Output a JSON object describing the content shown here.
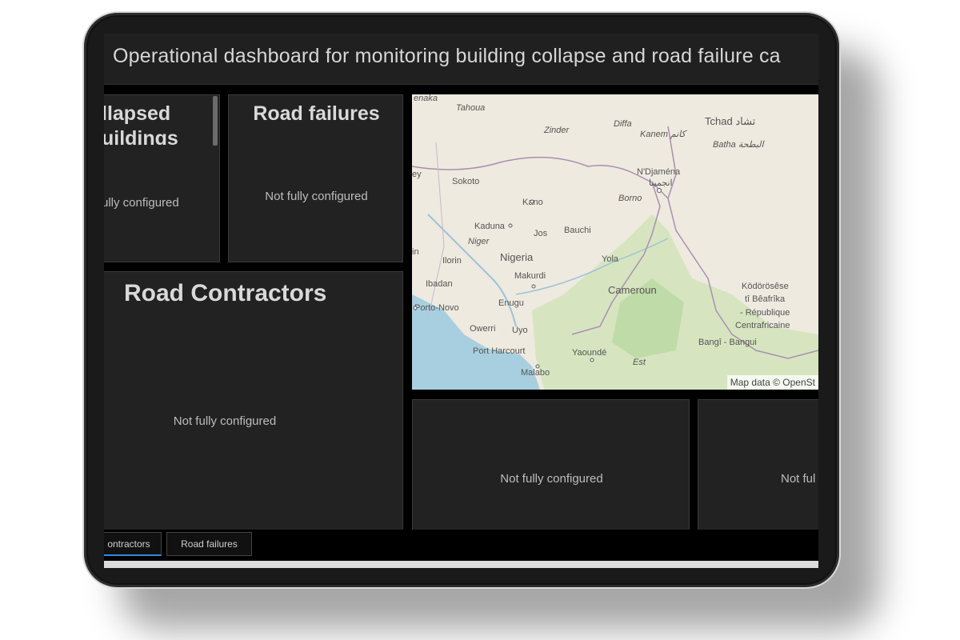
{
  "header": {
    "title": "Operational dashboard for monitoring building collapse and road failure ca"
  },
  "panels": {
    "collapsed_title_line1": "llapsed",
    "collapsed_title_line2": "uildings",
    "collapsed_status": "ully configured",
    "road_failures_title": "Road failures",
    "road_failures_status": "Not fully configured",
    "contractors_title": "Road Contractors",
    "contractors_status": "Not fully configured",
    "bottom_mid_status": "Not fully configured",
    "bottom_right_status": "Not ful"
  },
  "map": {
    "attribution": "Map data © OpenSt",
    "labels": {
      "tahoua": "Tahoua",
      "zinder": "Zinder",
      "diffa": "Diffa",
      "kanem": "Kanem كانم",
      "tchad": "Tchad تشاد",
      "batha": "Batha البطحة",
      "sokoto": "Sokoto",
      "kano": "Kano",
      "ndjamena": "N'Djaména",
      "ndjamena_ar": "انجمينا",
      "borno": "Borno",
      "kaduna": "Kaduna",
      "niger": "Niger",
      "jos": "Jos",
      "bauchi": "Bauchi",
      "ilorin": "Ilorin",
      "nigeria": "Nigeria",
      "yola": "Yola",
      "ibadan": "Ibadan",
      "makurdi": "Makurdi",
      "cameroun": "Cameroun",
      "porto_novo": "Porto-Novo",
      "enugu": "Enugu",
      "owerri": "Owerri",
      "uyo": "Uyo",
      "port_harcourt": "Port Harcourt",
      "yaounde": "Yaoundé",
      "malabo": "Malabo",
      "est": "Est",
      "bangui": "Bangî - Bangui",
      "car1": "Ködörösêse",
      "car2": "tî Bêafrîka",
      "car3": "- République",
      "car4": "Centrafricaine",
      "enaka": "enaka",
      "ey": "ey",
      "in": "in"
    }
  },
  "tabs": {
    "contractors": "ontractors",
    "road_failures": "Road failures"
  },
  "colors": {
    "accent": "#2f8de4",
    "panel": "#222222",
    "background": "#000000"
  }
}
